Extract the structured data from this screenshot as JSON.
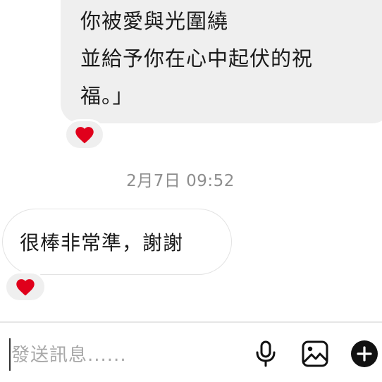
{
  "conversation": {
    "received_message": {
      "lines": [
        "你被愛與光圍繞",
        "並給予你在心中起伏的祝",
        "福。」"
      ],
      "reaction": "heart"
    },
    "timestamp": "2月7日 09:52",
    "sent_message": {
      "text": "很棒非常準，謝謝",
      "reaction": "heart"
    }
  },
  "composer": {
    "placeholder": "發送訊息......",
    "value": "",
    "icons": [
      "microphone-icon",
      "image-icon",
      "plus-icon"
    ]
  },
  "colors": {
    "incoming_bubble": "#efefef",
    "heart": "#e0001b",
    "timestamp": "#8e8e8e",
    "placeholder": "#a8a8a8",
    "icon": "#111111"
  }
}
